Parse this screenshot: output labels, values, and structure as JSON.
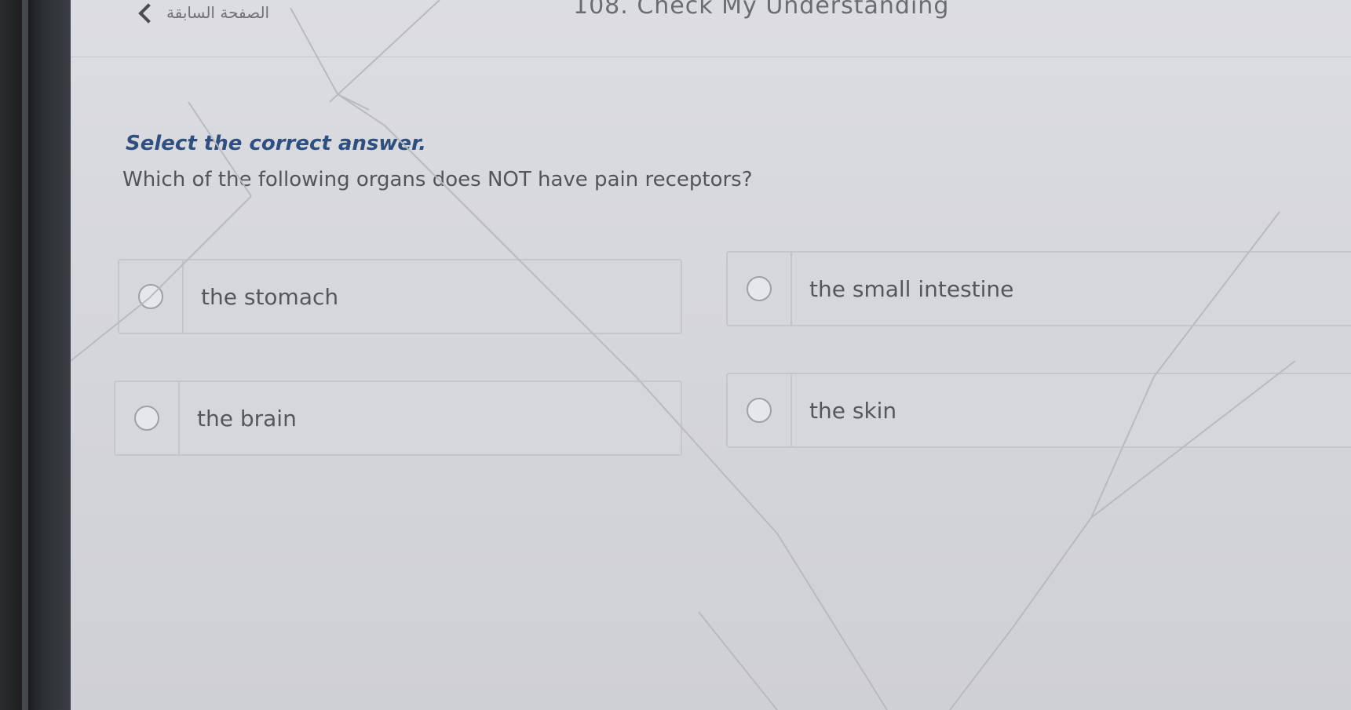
{
  "header": {
    "back_label": "الصفحة السابقة",
    "title": "108. Check My Understanding"
  },
  "quiz": {
    "instruction": "Select the correct answer.",
    "question": "Which of the following organs does NOT have pain receptors?",
    "options": [
      {
        "label": "the stomach",
        "selected": false
      },
      {
        "label": "the small intestine",
        "selected": false
      },
      {
        "label": "the brain",
        "selected": false
      },
      {
        "label": "the skin",
        "selected": false
      }
    ]
  },
  "colors": {
    "instruction": "#2f4f7e",
    "text": "#525459",
    "screen_bg": "#d6d7dc"
  }
}
